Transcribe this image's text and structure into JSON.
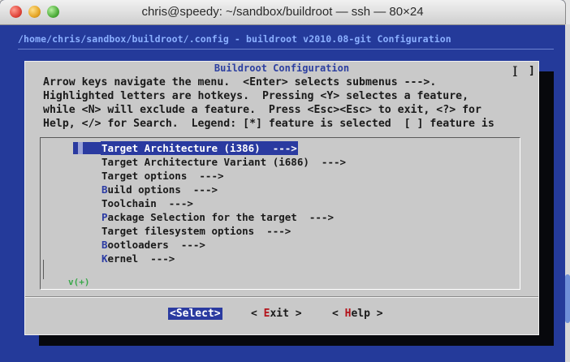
{
  "window": {
    "title": "chris@speedy: ~/sandbox/buildroot — ssh — 80×24"
  },
  "terminal": {
    "path_line": "/home/chris/sandbox/buildroot/.config - buildroot v2010.08-git Configuration",
    "dialog_title": " Buildroot Configuration ",
    "help_lines": [
      "Arrow keys navigate the menu.  <Enter> selects submenus --->.",
      "Highlighted letters are hotkeys.  Pressing <Y> selectes a feature,",
      "while <N> will exclude a feature.  Press <Esc><Esc> to exit, <?> for",
      "Help, </> for Search.  Legend: [*] feature is selected  [ ] feature is"
    ],
    "menu_items": [
      {
        "hotkey": "T",
        "rest": "arget Architecture (i386)  --->",
        "selected": true
      },
      {
        "hotkey": "",
        "rest": "Target Architecture Variant (i686)  --->",
        "selected": false
      },
      {
        "hotkey": "",
        "rest": "Target options  --->",
        "selected": false
      },
      {
        "hotkey": "B",
        "rest": "uild options  --->",
        "selected": false
      },
      {
        "hotkey": "",
        "rest": "Toolchain  --->",
        "selected": false
      },
      {
        "hotkey": "P",
        "rest": "ackage Selection for the target  --->",
        "selected": false
      },
      {
        "hotkey": "",
        "rest": "Target filesystem options  --->",
        "selected": false
      },
      {
        "hotkey": "B",
        "rest": "ootloaders  --->",
        "selected": false
      },
      {
        "hotkey": "K",
        "rest": "ernel  --->",
        "selected": false
      }
    ],
    "more_indicator": "v(+)",
    "buttons": {
      "select": {
        "pre": "<",
        "hk": "Select",
        "post": ">"
      },
      "exit": {
        "pre": "< ",
        "hk": "E",
        "post": "xit >"
      },
      "help": {
        "pre": "< ",
        "hk": "H",
        "post": "elp >"
      }
    }
  },
  "colors": {
    "terminal_bg": "#243a9a",
    "dialog_bg": "#c9c9c9",
    "highlight": "#2a3aa0",
    "button_hotkey": "#b3121a",
    "more_indicator": "#3aa84a"
  }
}
